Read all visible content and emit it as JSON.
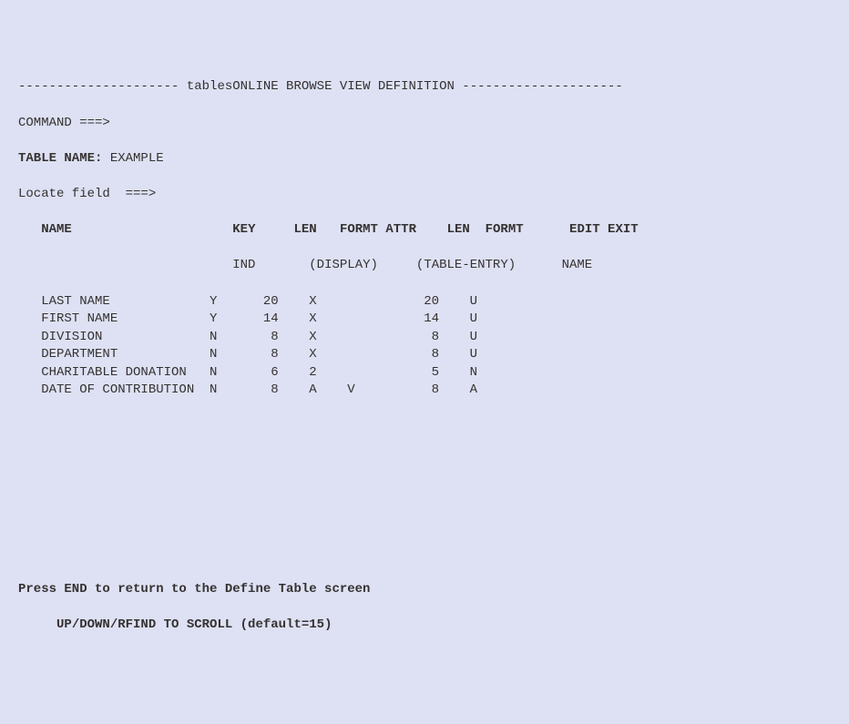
{
  "title_dashes_left": "---------------------",
  "title_text": " tablesONLINE BROWSE VIEW DEFINITION ",
  "title_dashes_right": "---------------------",
  "command_label": "COMMAND ===>",
  "command_value": "",
  "table_name_label": "TABLE NAME:",
  "table_name_value": "EXAMPLE",
  "locate_label": "Locate field  ===>",
  "locate_value": "",
  "headers": {
    "name": "NAME",
    "key": "KEY",
    "len1": "LEN",
    "formt1": "FORMT",
    "attr": "ATTR",
    "len2": "LEN",
    "formt2": "FORMT",
    "edit_exit": "EDIT EXIT",
    "ind": "IND",
    "display": "(DISPLAY)",
    "table_entry": "(TABLE-ENTRY)",
    "exit_name": "NAME"
  },
  "rows": [
    {
      "name": "LAST NAME",
      "key": "Y",
      "len1": "20",
      "formt1": "X",
      "attr": " ",
      "len2": "20",
      "formt2": "U"
    },
    {
      "name": "FIRST NAME",
      "key": "Y",
      "len1": "14",
      "formt1": "X",
      "attr": " ",
      "len2": "14",
      "formt2": "U"
    },
    {
      "name": "DIVISION",
      "key": "N",
      "len1": "8",
      "formt1": "X",
      "attr": " ",
      "len2": "8",
      "formt2": "U"
    },
    {
      "name": "DEPARTMENT",
      "key": "N",
      "len1": "8",
      "formt1": "X",
      "attr": " ",
      "len2": "8",
      "formt2": "U"
    },
    {
      "name": "CHARITABLE DONATION",
      "key": "N",
      "len1": "6",
      "formt1": "2",
      "attr": " ",
      "len2": "5",
      "formt2": "N"
    },
    {
      "name": "DATE OF CONTRIBUTION",
      "key": "N",
      "len1": "8",
      "formt1": "A",
      "attr": "V",
      "len2": "8",
      "formt2": "A"
    }
  ],
  "footer1": "Press END to return to the Define Table screen",
  "footer2": "UP/DOWN/RFIND TO SCROLL (default=15)"
}
